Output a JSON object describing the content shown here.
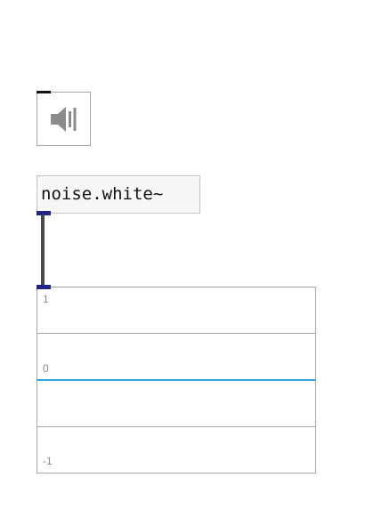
{
  "speaker": {
    "icon": "speaker-icon",
    "state": "off"
  },
  "noise_object": {
    "label": "noise.white~"
  },
  "scope": {
    "ticks": {
      "top": "1",
      "mid": "0",
      "bottom": "-1"
    },
    "signal_value": 0,
    "colors": {
      "signal": "#29a8e0",
      "grid": "#a6a6a6"
    }
  },
  "colors": {
    "port": "#232388",
    "cord": "#4a4a4a",
    "object_fill": "#f7f7f7"
  }
}
